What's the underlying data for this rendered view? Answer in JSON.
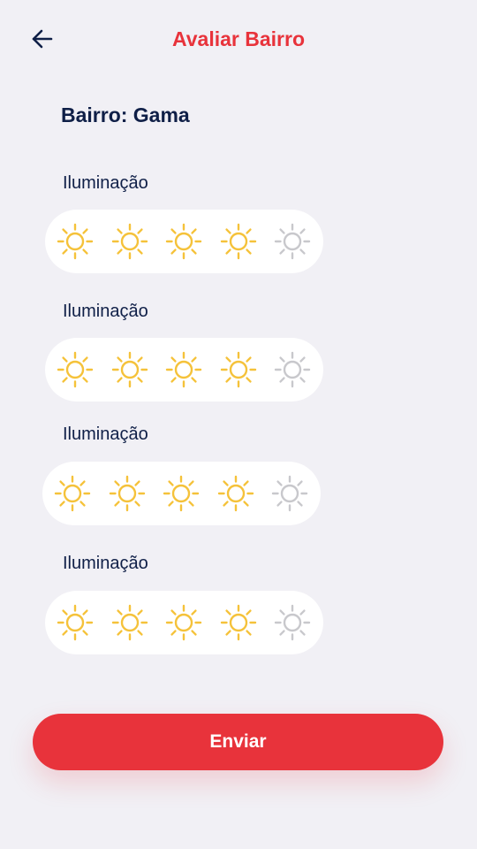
{
  "header": {
    "title": "Avaliar Bairro",
    "back_icon": "arrow-left-icon"
  },
  "neighborhood": {
    "label": "Bairro: Gama"
  },
  "categories": [
    {
      "label": "Iluminação",
      "rating": 4,
      "max": 5
    },
    {
      "label": "Iluminação",
      "rating": 4,
      "max": 5
    },
    {
      "label": "Iluminação",
      "rating": 4,
      "max": 5
    },
    {
      "label": "Iluminação",
      "rating": 4,
      "max": 5
    }
  ],
  "rating_icon": "sun-icon",
  "colors": {
    "accent": "#e8333b",
    "text_primary": "#0f1f47",
    "sun_active": "#f5c23a",
    "sun_inactive": "#c8c8cc",
    "background": "#f1f0f5",
    "pill": "#ffffff"
  },
  "submit": {
    "label": "Enviar"
  }
}
